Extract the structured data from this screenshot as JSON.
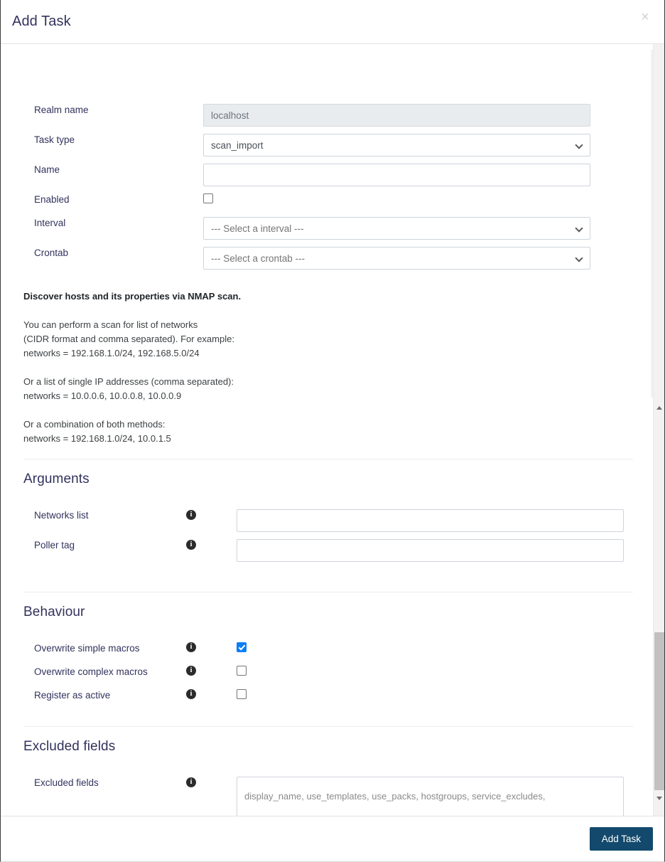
{
  "dialog": {
    "title": "Add Task",
    "close_label": "×"
  },
  "form": {
    "fields": [
      {
        "label": "Realm name",
        "type": "text",
        "value": "localhost",
        "disabled": true
      },
      {
        "label": "Task type",
        "type": "select",
        "value": "scan_import"
      },
      {
        "label": "Name",
        "type": "text",
        "value": ""
      },
      {
        "label": "Enabled",
        "type": "checkbox",
        "checked": false
      },
      {
        "label": "Interval",
        "type": "select",
        "value": "--- Select a interval ---"
      },
      {
        "label": "Crontab",
        "type": "select",
        "value": "--- Select a crontab ---"
      }
    ]
  },
  "description": {
    "heading": "Discover hosts and its properties via NMAP scan.",
    "paragraphs": [
      [
        "You can perform a scan for list of networks",
        "(CIDR format and comma separated). For example:",
        "networks = 192.168.1.0/24, 192.168.5.0/24"
      ],
      [
        "Or a list of single IP addresses (comma separated):",
        "networks = 10.0.0.6, 10.0.0.8, 10.0.0.9"
      ],
      [
        "Or a combination of both methods:",
        "networks = 192.168.1.0/24, 10.0.1.5"
      ]
    ]
  },
  "arguments": {
    "title": "Arguments",
    "rows": [
      {
        "label": "Networks list",
        "info": "i",
        "value": ""
      },
      {
        "label": "Poller tag",
        "info": "i",
        "value": ""
      }
    ]
  },
  "behaviour": {
    "title": "Behaviour",
    "rows": [
      {
        "label": "Overwrite simple macros",
        "info": "i",
        "checked": true
      },
      {
        "label": "Overwrite complex macros",
        "info": "i",
        "checked": false
      },
      {
        "label": "Register as active",
        "info": "i",
        "checked": false
      }
    ]
  },
  "excluded": {
    "title": "Excluded fields",
    "row": {
      "label": "Excluded fields",
      "info": "i",
      "placeholder": "display_name, use_templates, use_packs, hostgroups, service_excludes, service_includes, service_overrides",
      "value": ""
    }
  },
  "footer": {
    "submit_label": "Add Task"
  },
  "colors": {
    "primary_button": "#12496c",
    "checkbox_checked": "#0b7ef4",
    "title": "#32325d"
  }
}
